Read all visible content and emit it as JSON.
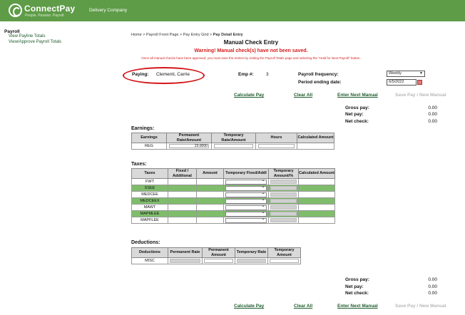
{
  "header": {
    "brand": "ConnectPay",
    "tagline": "People. Passion. Payroll.",
    "company": "Delivery Company"
  },
  "sidebar": {
    "title": "Payroll",
    "links": [
      "View Payline Totals",
      "View/Approve Payroll Totals"
    ]
  },
  "breadcrumb": {
    "path": "Home > Payroll Front Page > Pay Entry Grid > ",
    "current": "Pay Detail Entry"
  },
  "page": {
    "title": "Manual Check Entry",
    "warning": "Warning! Manual check(s) have not been saved.",
    "warning_note": "Once all manual checks have been approved, you must save the entries by visiting the Payroll Totals page and selecting the \"Hold for Next Payroll\" button."
  },
  "employee": {
    "paying_label": "Paying:",
    "paying_value": "Clementi, Carrie",
    "emp_label": "Emp #:",
    "emp_value": "3",
    "freq_label": "Payroll frequency:",
    "freq_value": "Weekly",
    "period_label": "Period ending date:",
    "period_value": "6/5/2022"
  },
  "actions": {
    "calculate": "Calculate Pay",
    "clear": "Clear All",
    "next": "Enter Next Manual",
    "save": "Save Pay / New Manual"
  },
  "summary": [
    {
      "label": "Gross pay:",
      "value": "0.00"
    },
    {
      "label": "Net pay:",
      "value": "0.00"
    },
    {
      "label": "Net check:",
      "value": "0.00"
    }
  ],
  "earnings": {
    "title": "Earnings:",
    "headers": [
      "Earnings",
      "Permanent Rate/Amount",
      "Temporary Rate/Amount",
      "Hours",
      "Calculated Amount"
    ],
    "rows": [
      {
        "name": "REG",
        "rate": "23.0000"
      }
    ]
  },
  "taxes": {
    "title": "Taxes:",
    "headers": [
      "Taxes",
      "Fixed / Additional",
      "Amount",
      "Temporary Fixed/Addl",
      "Temporary Amount/%",
      "Calculated Amount"
    ],
    "rows": [
      "FWT",
      "SSEE",
      "MEDCEE",
      "MEDCEEX",
      "MAWT",
      "MAPMLEE",
      "MAPFLEE"
    ]
  },
  "deductions": {
    "title": "Deductions:",
    "headers": [
      "Deductions",
      "Permanent Rate",
      "Permanent Amount",
      "Temporary Rate",
      "Temporary Amount"
    ],
    "rows": [
      "MISC"
    ]
  },
  "colors": {
    "brand_green": "#5e9c47",
    "row_green": "#7fbd6b",
    "warning_red": "#d62020",
    "link_green": "#1f5c2e"
  }
}
